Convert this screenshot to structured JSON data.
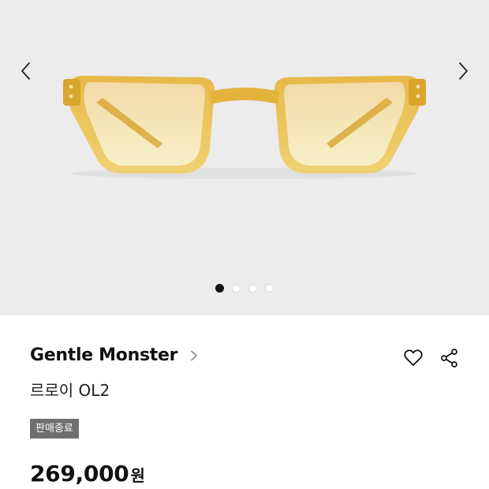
{
  "gallery": {
    "image_label": "yellow-transparent-square-sunglasses",
    "slide_count": 4,
    "active_slide": 1
  },
  "product": {
    "brand": "Gentle Monster",
    "name": "르로이 OL2",
    "status_badge": "판매종료",
    "price": "269,000",
    "currency": "원"
  },
  "colors": {
    "gallery_bg": "#ececec",
    "badge_bg": "#6f6f6f",
    "frame_color": "#e2b43c"
  },
  "icons": {
    "prev": "chevron-left-icon",
    "next": "chevron-right-icon",
    "brand_link": "chevron-right-icon",
    "wishlist": "heart-icon",
    "share": "share-icon"
  }
}
